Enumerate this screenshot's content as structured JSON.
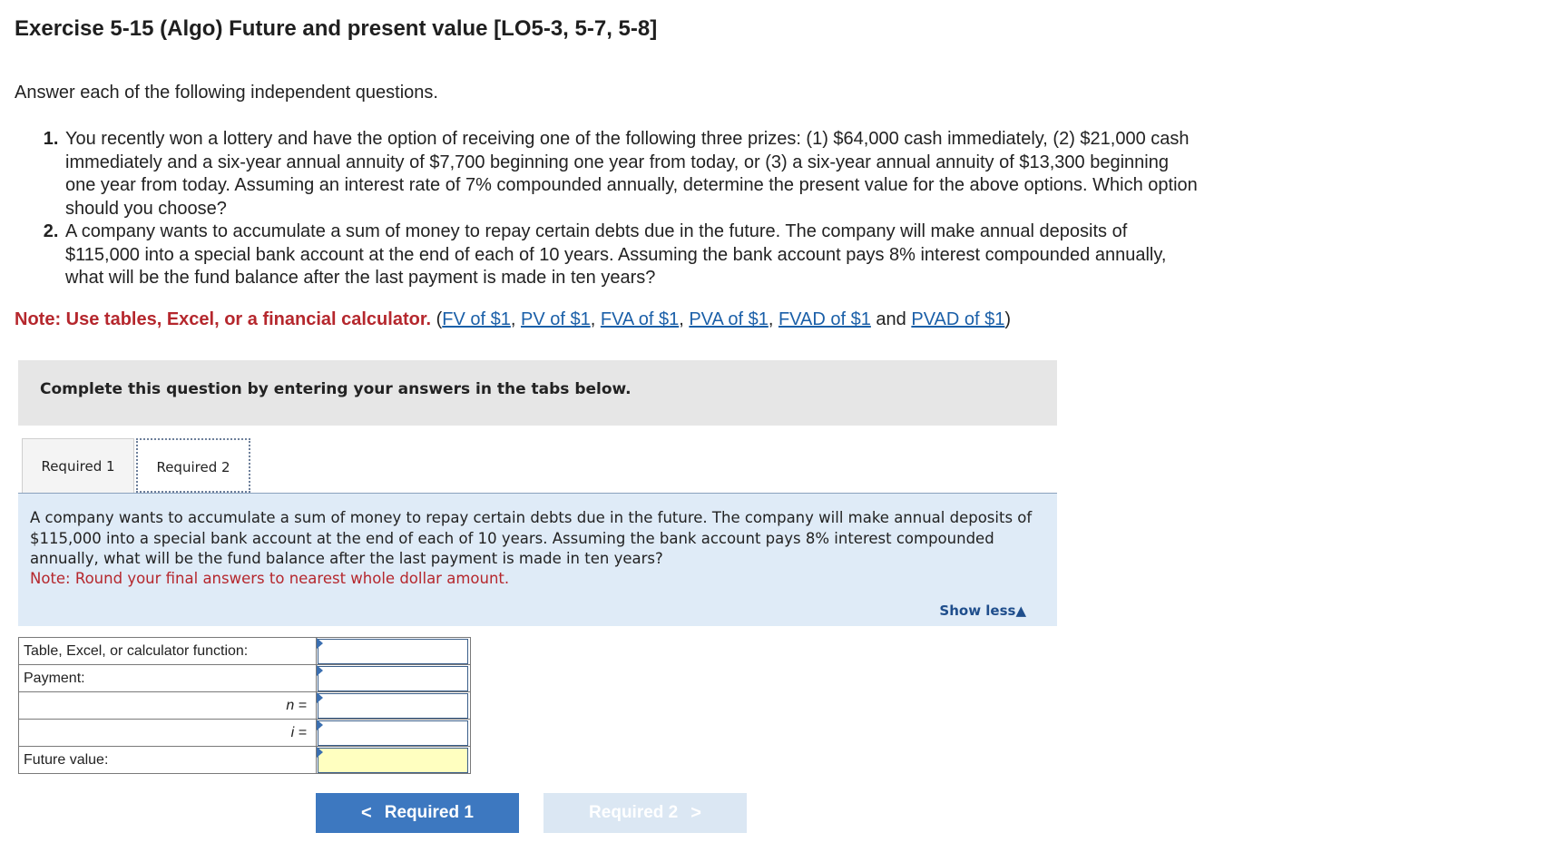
{
  "title": "Exercise 5-15 (Algo) Future and present value [LO5-3, 5-7, 5-8]",
  "intro": "Answer each of the following independent questions.",
  "questions": [
    "You recently won a lottery and have the option of receiving one of the following three prizes: (1) $64,000 cash immediately, (2) $21,000 cash immediately and a six-year annual annuity of $7,700 beginning one year from today, or (3) a six-year annual annuity of $13,300 beginning one year from today. Assuming an interest rate of 7% compounded annually, determine the present value for the above options. Which option should you choose?",
    "A company wants to accumulate a sum of money to repay certain debts due in the future. The company will make annual deposits of $115,000 into a special bank account at the end of each of 10 years. Assuming the bank account pays 8% interest compounded annually, what will be the fund balance after the last payment is made in ten years?"
  ],
  "note": {
    "label": "Note: Use tables, Excel, or a financial calculator.",
    "links": [
      "FV of $1",
      "PV of $1",
      "FVA of $1",
      "PVA of $1",
      "FVAD of $1",
      "PVAD of $1"
    ],
    "and": "and"
  },
  "instructions": "Complete this question by entering your answers in the tabs below.",
  "tabs": [
    {
      "label": "Required 1",
      "active": false
    },
    {
      "label": "Required 2",
      "active": true
    }
  ],
  "panel": {
    "question": "A company wants to accumulate a sum of money to repay certain debts due in the future. The company will make annual deposits of $115,000 into a special bank account at the end of each of 10 years. Assuming the bank account pays 8% interest compounded annually, what will be the fund balance after the last payment is made in ten years?",
    "round_note": "Note: Round your final answers to nearest whole dollar amount.",
    "show_less": "Show less▲"
  },
  "calc_table": {
    "rows": [
      {
        "label": "Table, Excel, or calculator function:",
        "value": ""
      },
      {
        "label": "Payment:",
        "value": ""
      },
      {
        "label": "n =",
        "value": ""
      },
      {
        "label": "i =",
        "value": ""
      },
      {
        "label": "Future value:",
        "value": ""
      }
    ]
  },
  "nav": {
    "prev_label": "Required 1",
    "next_label": "Required 2",
    "prev_chevron": "<",
    "next_chevron": ">"
  }
}
